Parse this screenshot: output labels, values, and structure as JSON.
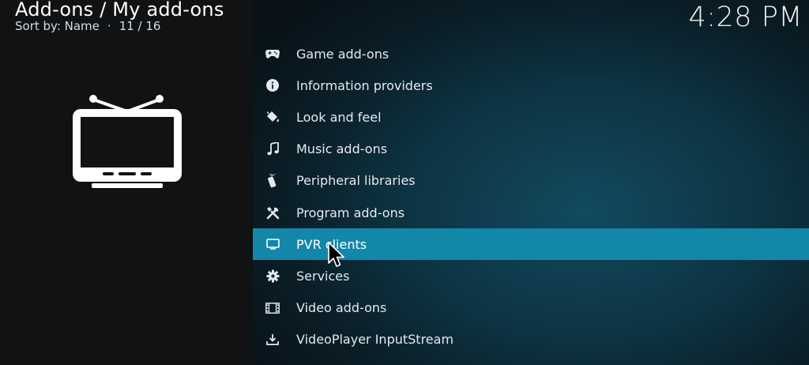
{
  "header": {
    "title": "Add-ons / My add-ons",
    "sort_label": "Sort by: Name",
    "separator": "·",
    "position": "11 / 16"
  },
  "clock": "4:28 PM",
  "preview": {
    "icon": "tv-icon"
  },
  "menu": {
    "selected_index": 6,
    "items": [
      {
        "label": "Game add-ons",
        "icon": "gamepad-icon"
      },
      {
        "label": "Information providers",
        "icon": "info-icon"
      },
      {
        "label": "Look and feel",
        "icon": "paint-bucket-icon"
      },
      {
        "label": "Music add-ons",
        "icon": "music-note-icon"
      },
      {
        "label": "Peripheral libraries",
        "icon": "remote-icon"
      },
      {
        "label": "Program add-ons",
        "icon": "tools-icon"
      },
      {
        "label": "PVR clients",
        "icon": "tv-small-icon"
      },
      {
        "label": "Services",
        "icon": "gear-icon"
      },
      {
        "label": "Video add-ons",
        "icon": "film-icon"
      },
      {
        "label": "VideoPlayer InputStream",
        "icon": "download-icon"
      }
    ]
  },
  "colors": {
    "highlight": "#1387a9",
    "left_panel": "#101214",
    "background": "#0d3342"
  }
}
